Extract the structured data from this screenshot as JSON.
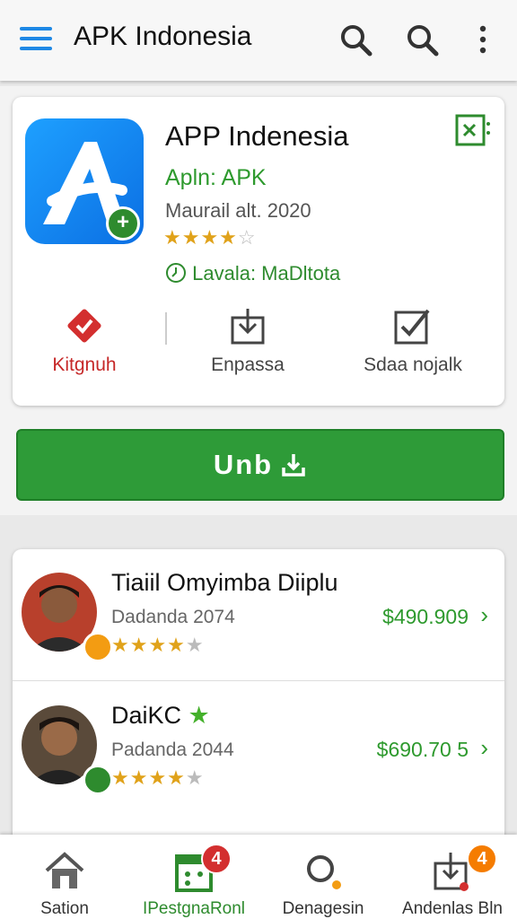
{
  "topbar": {
    "title": "APK Indonesia"
  },
  "app": {
    "title": "APP Indenesia",
    "subtitle": "Apln: APK",
    "date": "Maurail alt. 2020",
    "rating": 3.5,
    "badge": "Lavala: MaDltota",
    "actions": [
      {
        "label": "Kitgnuh",
        "icon": "diamond-check-icon"
      },
      {
        "label": "Enpassa",
        "icon": "download-box-icon"
      },
      {
        "label": "Sdaa nojalk",
        "icon": "checkbox-icon"
      }
    ],
    "main_button": "Unb"
  },
  "list": [
    {
      "name": "Tiaiil Omyimba Diiplu",
      "date": "Dadanda 2074",
      "price": "$490.909",
      "rating": 3.5
    },
    {
      "name": "DaiKC",
      "date": "Padanda 2044",
      "price": "$690.70 5",
      "rating": 3.5
    }
  ],
  "bottom_nav": [
    {
      "label": "Sation",
      "icon": "home-icon",
      "badge": ""
    },
    {
      "label": "IPestgnaRonl",
      "icon": "calendar-icon",
      "badge": "4"
    },
    {
      "label": "Denagesin",
      "icon": "search-icon",
      "badge": ""
    },
    {
      "label": "Andenlas Bln",
      "icon": "download-icon",
      "badge": "4"
    }
  ],
  "colors": {
    "accent_green": "#2e9b38",
    "menu_blue": "#1e88e5",
    "badge_red": "#d32f2f",
    "badge_orange": "#f57c00",
    "star": "#e0a21a"
  }
}
